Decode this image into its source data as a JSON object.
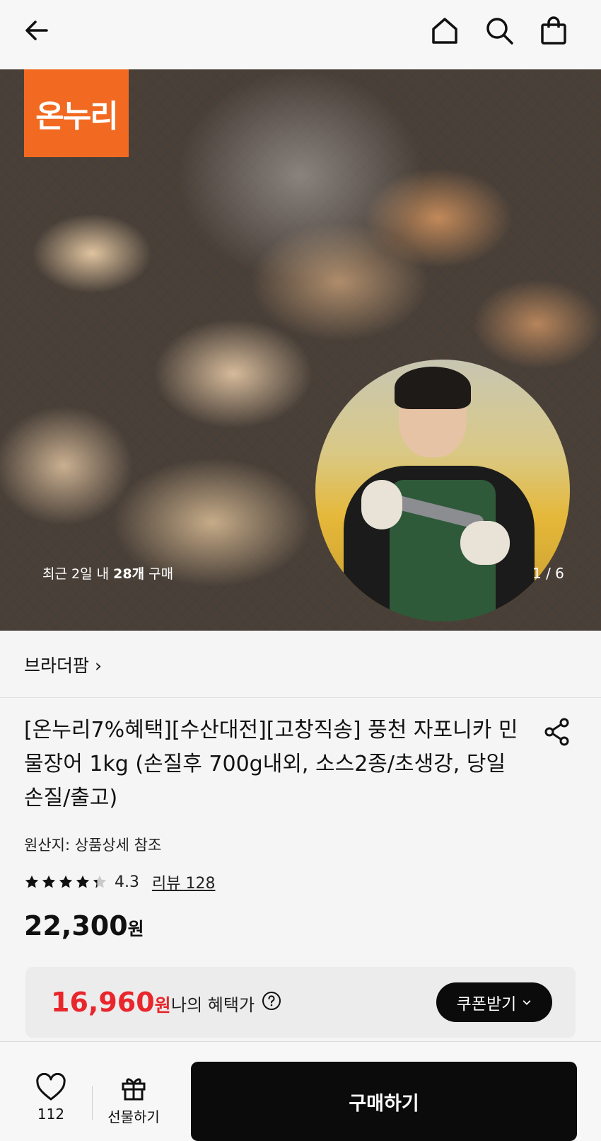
{
  "header": {
    "back_icon": "arrow-left-icon",
    "home_icon": "home-icon",
    "search_icon": "search-icon",
    "cart_icon": "shopping-bag-icon"
  },
  "gallery": {
    "logo_text": "온누리",
    "logo_color": "#f26a22",
    "recent_prefix": "최근 2일 내 ",
    "recent_count": "28개",
    "recent_suffix": " 구매",
    "pager": "1 / 6",
    "current_image": 1,
    "total_images": 6
  },
  "brand": {
    "name": "브라더팜 ›"
  },
  "product": {
    "title": "[온누리7%혜택][수산대전][고창직송] 풍천 자포니카 민물장어 1kg (손질후 700g내외, 소스2종/초생강, 당일 손질/출고)",
    "origin": "원산지: 상품상세 참조",
    "rating": "4.3",
    "rating_value": 4.3,
    "rating_max": 5,
    "review_label": "리뷰 128",
    "price": "22,300",
    "price_unit": "원"
  },
  "benefit": {
    "price": "16,960",
    "price_unit": "원",
    "label": "나의 혜택가",
    "coupon_label": "쿠폰받기",
    "accent_color": "#e8262c"
  },
  "bottom": {
    "like_count": "112",
    "gift_label": "선물하기",
    "buy_label": "구매하기"
  }
}
